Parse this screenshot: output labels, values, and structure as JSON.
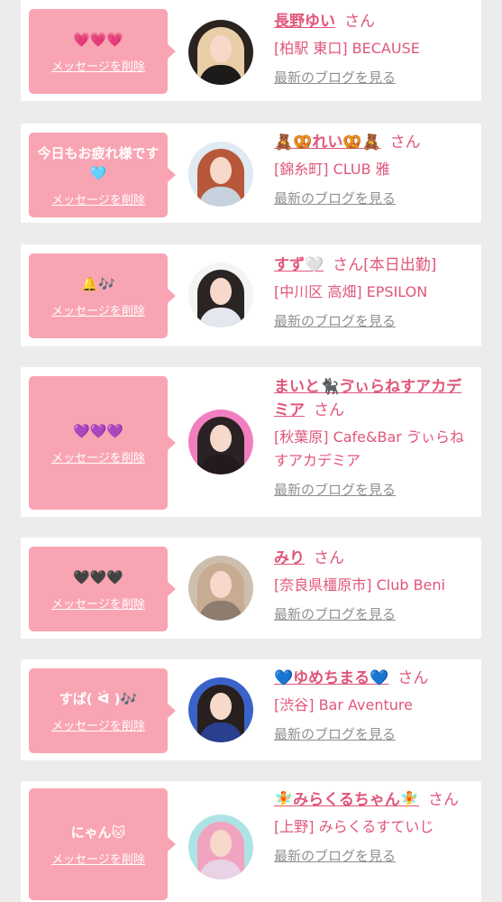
{
  "delete_label": "メッセージを削除",
  "blog_label": "最新のブログを見る",
  "san_label": "さん",
  "accent_pink": "#f9a4b2",
  "text_pink": "#e0567a",
  "cards": [
    {
      "message": "💗💗💗",
      "name": "長野ゆい",
      "shop": "[柏駅 東口] BECAUSE",
      "avatar": "woman-portrait-blonde"
    },
    {
      "message": "今日もお疲れ様です🩵",
      "name": "🧸🥨れい🥨🧸",
      "shop": "[錦糸町] CLUB 雅",
      "avatar": "woman-portrait-redhair"
    },
    {
      "message": "🔔🎶",
      "name": "すず🤍",
      "name_suffix": "[本日出勤]",
      "shop": "[中川区 高畑] EPSILON",
      "avatar": "woman-portrait-dark"
    },
    {
      "message": "💜💜💜",
      "name": "まいと🐈‍⬛ゔぃらねすアカデミア",
      "shop": "[秋葉原] Cafe&Bar ゔぃらねすアカデミア",
      "avatar": "woman-portrait-pink"
    },
    {
      "message": "🖤🖤🖤",
      "name": "みり",
      "shop": "[奈良県橿原市] Club Beni",
      "avatar": "woman-portrait-lightbrown"
    },
    {
      "message": "すぱ( ᐛ )🎶",
      "name": "💙ゆめちまる💙",
      "shop": "[渋谷] Bar Aventure",
      "avatar": "woman-portrait-blue"
    },
    {
      "message": "にゃん🐱",
      "name": "🧚みらくるちゃん🧚",
      "shop": "[上野] みらくるすていじ",
      "avatar": "woman-portrait-pastel"
    }
  ]
}
